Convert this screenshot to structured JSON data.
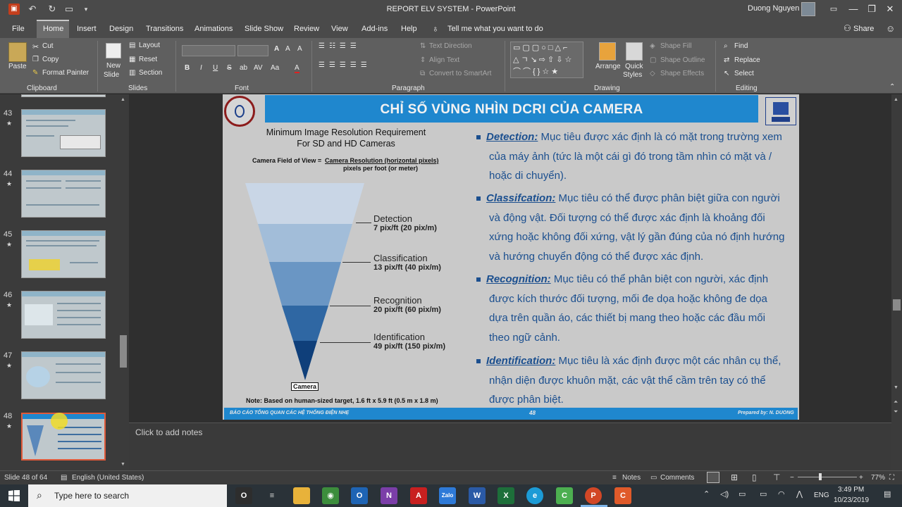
{
  "window": {
    "title": "REPORT ELV SYSTEM  -  PowerPoint",
    "user": "Duong Nguyen"
  },
  "tabs": [
    "File",
    "Home",
    "Insert",
    "Design",
    "Transitions",
    "Animations",
    "Slide Show",
    "Review",
    "View",
    "Add-ins",
    "Help"
  ],
  "tell_me": "Tell me what you want to do",
  "share": "Share",
  "ribbon": {
    "paste": "Paste",
    "cut": "Cut",
    "copy": "Copy",
    "format_painter": "Format Painter",
    "clipboard": "Clipboard",
    "new_slide_1": "New",
    "new_slide_2": "Slide",
    "layout": "Layout",
    "reset": "Reset",
    "section": "Section",
    "slides": "Slides",
    "font_btns": [
      "B",
      "I",
      "U",
      "S",
      "ab",
      "AV",
      "Aa",
      "A"
    ],
    "font": "Font",
    "text_direction": "Text Direction",
    "align_text": "Align Text",
    "convert_smartart": "Convert to SmartArt",
    "paragraph": "Paragraph",
    "arrange": "Arrange",
    "quick_styles_1": "Quick",
    "quick_styles_2": "Styles",
    "shape_fill": "Shape Fill",
    "shape_outline": "Shape Outline",
    "shape_effects": "Shape Effects",
    "drawing": "Drawing",
    "find": "Find",
    "replace": "Replace",
    "select": "Select",
    "editing": "Editing"
  },
  "thumbnails": [
    {
      "num": "43",
      "star": "★"
    },
    {
      "num": "44",
      "star": "★"
    },
    {
      "num": "45",
      "star": "★"
    },
    {
      "num": "46",
      "star": "★"
    },
    {
      "num": "47",
      "star": "★"
    },
    {
      "num": "48",
      "star": "★"
    }
  ],
  "slide": {
    "title": "CHỈ SỐ VÙNG NHÌN DCRI CỦA CAMERA",
    "figure_title_1": "Minimum Image Resolution Requirement",
    "figure_title_2": "For SD and HD Cameras",
    "formula_lhs": "Camera Field of View = ",
    "formula_num": "Camera Resolution (horizontal pixels)",
    "formula_den": "pixels per foot (or meter)",
    "levels": [
      {
        "name": "Detection",
        "value": "7 pix/ft (20 pix/m)",
        "color": "#c9d6e6"
      },
      {
        "name": "Classification",
        "value": "13 pix/ft (40 pix/m)",
        "color": "#a2bdd9"
      },
      {
        "name": "Recognition",
        "value": "20 pix/ft (60 pix/m)",
        "color": "#6a96c4"
      },
      {
        "name": "Identification",
        "value": "49 pix/ft (150 pix/m)",
        "color": "#2f67a3"
      }
    ],
    "camera_label": "Camera",
    "note": "Note: Based on human-sized target, 1.6 ft x 5.9 ft (0.5 m x 1.8 m)",
    "bullets": [
      {
        "term": "Detection:",
        "lines": [
          "Mục tiêu được xác định là có mặt trong trường xem",
          "của máy ảnh (tức là một cái gì đó trong tầm nhìn có mặt và /",
          "hoặc di chuyển)."
        ]
      },
      {
        "term": "Classifcation:",
        "lines": [
          "Mục tiêu có thể được phân biệt giữa con người",
          "và động vật. Đối tượng có thể được xác định là khoảng đối",
          "xứng hoặc không đối xứng, vật lý gần đúng của nó định hướng",
          "và hướng chuyển động có thể được xác định."
        ]
      },
      {
        "term": "Recognition:",
        "lines": [
          "Mục tiêu có thể phân biệt con người, xác định",
          "được kích thước đối tượng, mối đe dọa hoặc không đe dọa",
          "dựa trên quần áo, các thiết bị mang theo hoặc các đầu mối",
          "theo ngữ cảnh."
        ]
      },
      {
        "term": "Identification:",
        "lines": [
          "Mục tiêu là xác định được một các nhân cụ thể,",
          "nhận diện được khuôn mặt, các vật thể cầm trên tay có thể",
          "được phân biệt."
        ]
      }
    ],
    "footer_left": "BÁO CÁO TỔNG QUAN CÁC HỆ THỐNG ĐIỆN NHẸ",
    "footer_num": "48",
    "footer_right": "Prepared by: N. DUONG"
  },
  "notes_placeholder": "Click to add notes",
  "status": {
    "slide_of": "Slide 48 of 64",
    "language": "English (United States)",
    "notes": "Notes",
    "comments": "Comments",
    "zoom": "77%"
  },
  "taskbar": {
    "search": "Type here to search",
    "apps": [
      {
        "label": "O",
        "color": "#2d2d2d",
        "text": "#fff"
      },
      {
        "label": "≡",
        "color": "#2a3238",
        "text": "#ddd"
      },
      {
        "label": "",
        "color": "#e8b23a",
        "text": "#fff"
      },
      {
        "label": "◉",
        "color": "#3c8d3c",
        "text": "#fff"
      },
      {
        "label": "O",
        "color": "#1e64b4",
        "text": "#fff"
      },
      {
        "label": "N",
        "color": "#7b3ea8",
        "text": "#fff"
      },
      {
        "label": "A",
        "color": "#c82020",
        "text": "#fff"
      },
      {
        "label": "Zalo",
        "color": "#2e7ad8",
        "text": "#fff"
      },
      {
        "label": "W",
        "color": "#2a5aa6",
        "text": "#fff"
      },
      {
        "label": "X",
        "color": "#1d6f3a",
        "text": "#fff"
      },
      {
        "label": "e",
        "color": "#1c9bd6",
        "text": "#fff"
      },
      {
        "label": "C",
        "color": "#4caf50",
        "text": "#fff"
      },
      {
        "label": "P",
        "color": "#d24726",
        "text": "#fff"
      },
      {
        "label": "C",
        "color": "#e05a2a",
        "text": "#fff"
      }
    ],
    "ime": "ENG",
    "time": "3:49 PM",
    "date": "10/23/2019"
  }
}
